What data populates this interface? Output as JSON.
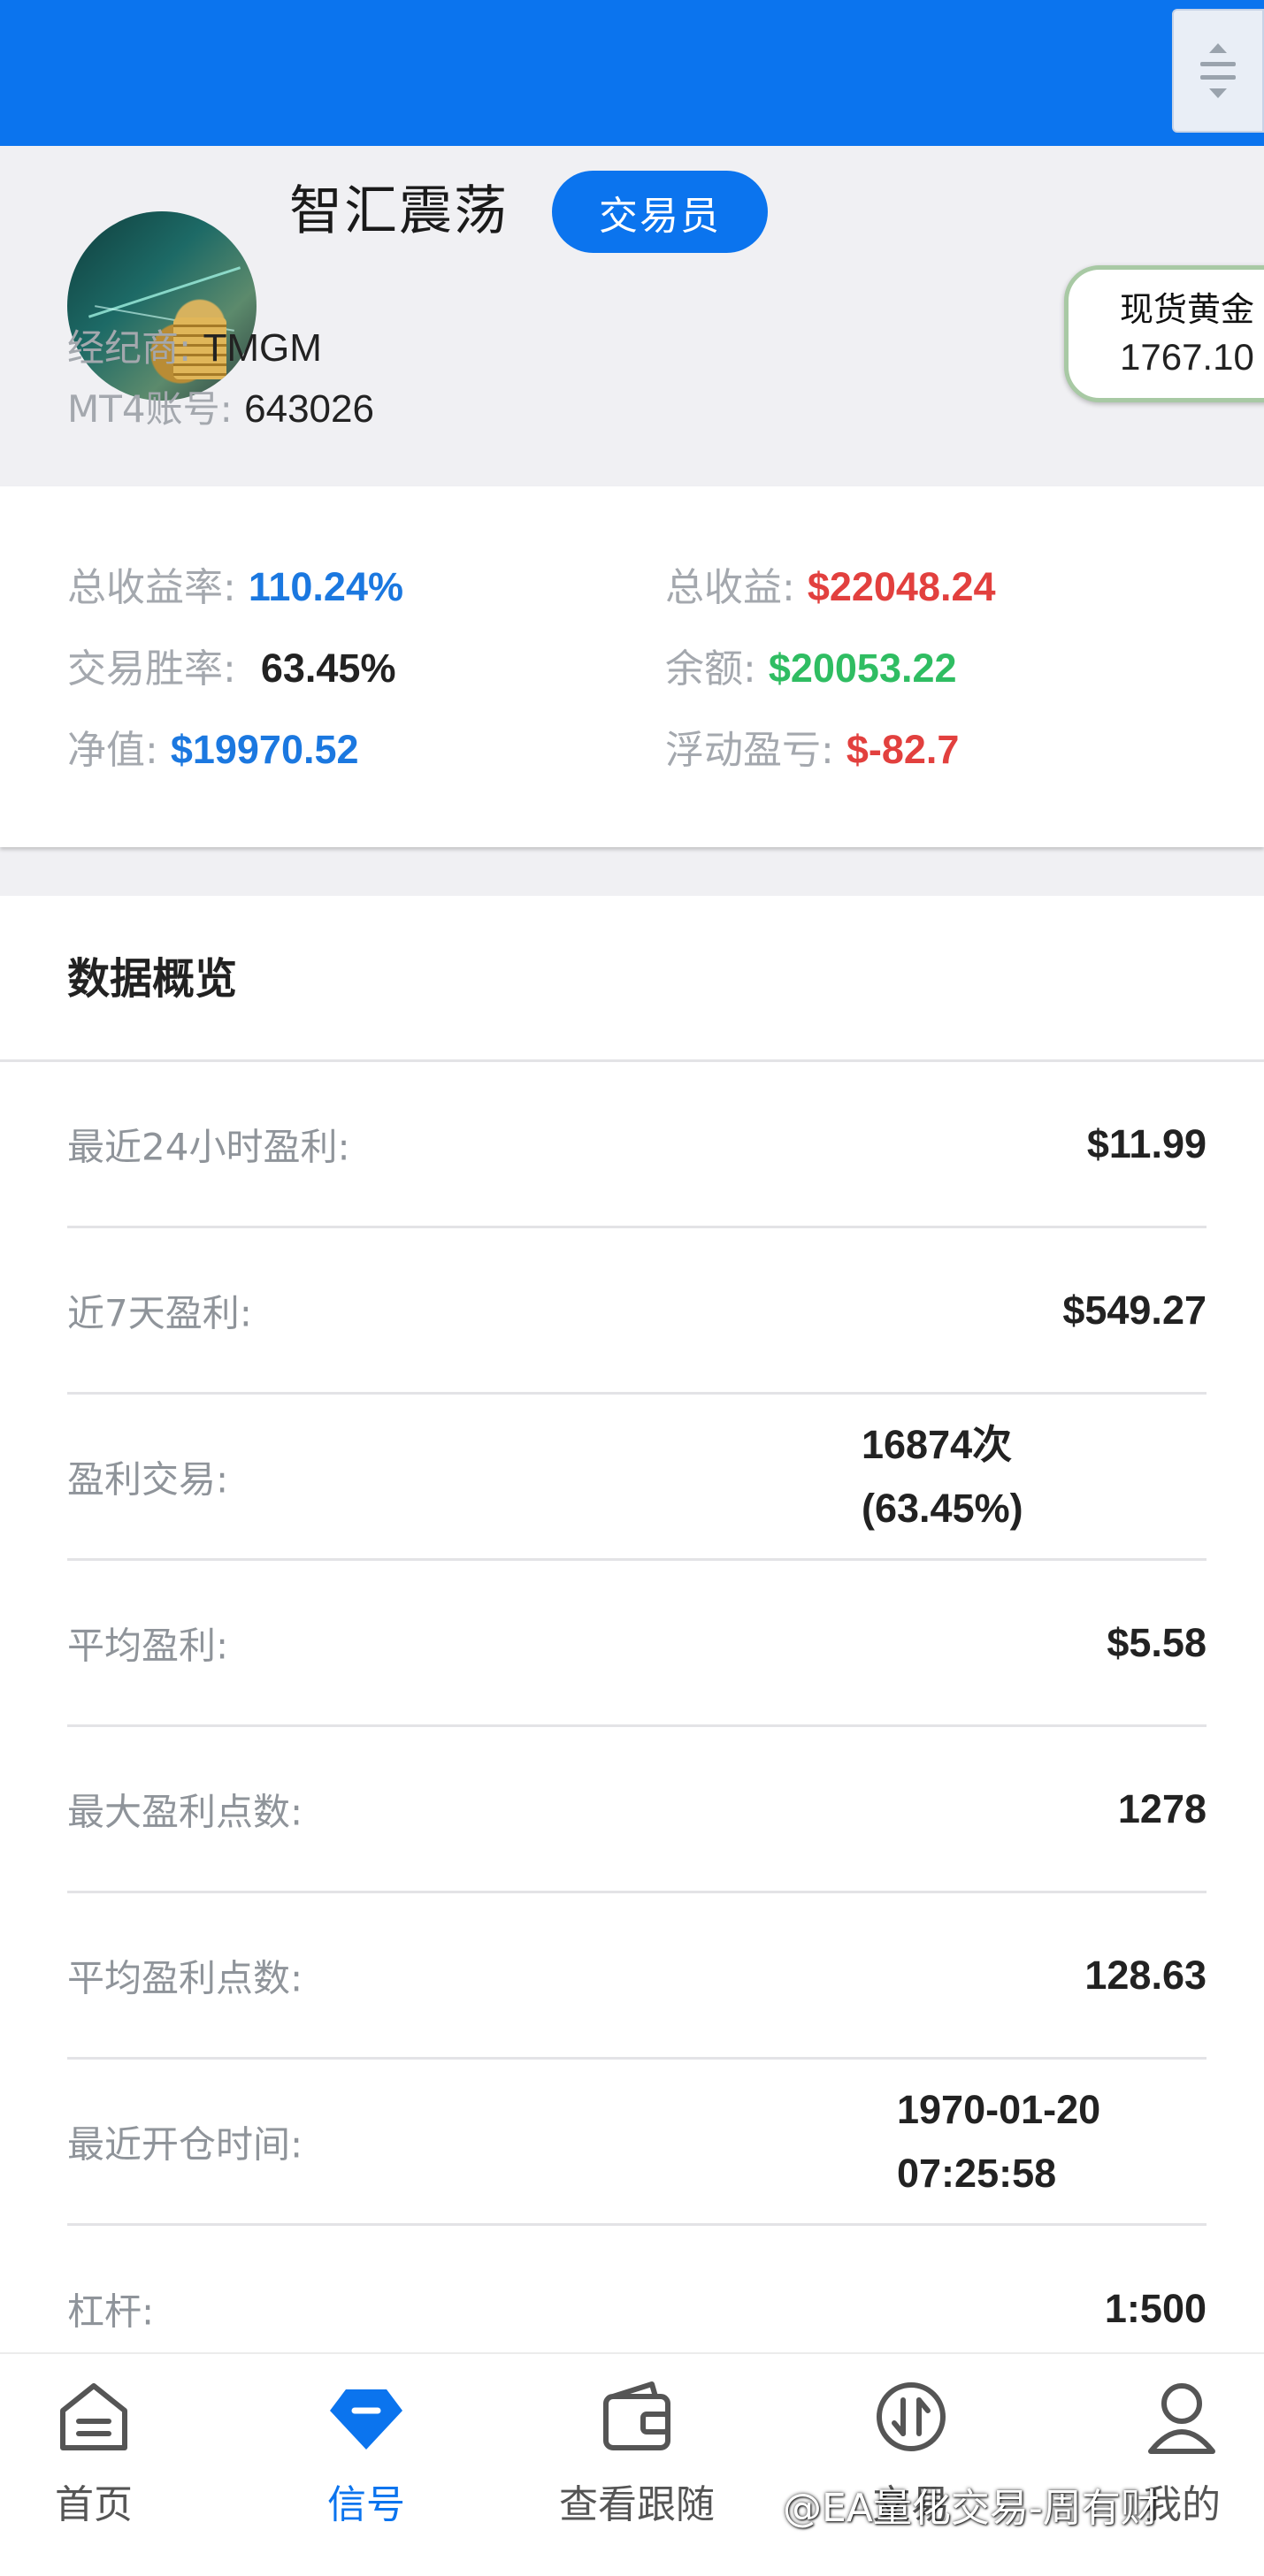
{
  "header": {
    "bg_color": "#0b74ee"
  },
  "profile": {
    "name": "智汇震荡",
    "badge": "交易员",
    "broker_label": "经纪商:",
    "broker_value": "TMGM",
    "account_label": "MT4账号:",
    "account_value": "643026"
  },
  "gold_ticker": {
    "label": "现货黄金",
    "price": "1767.10"
  },
  "stats": {
    "total_return_rate_label": "总收益率:",
    "total_return_rate_value": "110.24%",
    "total_profit_label": "总收益:",
    "total_profit_value": "$22048.24",
    "win_rate_label": "交易胜率:",
    "win_rate_value": "63.45%",
    "balance_label": "余额:",
    "balance_value": "$20053.22",
    "equity_label": "净值:",
    "equity_value": "$19970.52",
    "floating_label": "浮动盈亏:",
    "floating_value": "$-82.7"
  },
  "overview": {
    "title": "数据概览",
    "rows": [
      {
        "label": "最近24小时盈利:",
        "value": "$11.99"
      },
      {
        "label": "近7天盈利:",
        "value": "$549.27"
      },
      {
        "label": "盈利交易:",
        "value_line1": "16874次",
        "value_line2": "(63.45%)"
      },
      {
        "label": "平均盈利:",
        "value": "$5.58"
      },
      {
        "label": "最大盈利点数:",
        "value": "1278"
      },
      {
        "label": "平均盈利点数:",
        "value": "128.63"
      },
      {
        "label": "最近开仓时间:",
        "value_line1": "1970-01-20",
        "value_line2": "07:25:58"
      },
      {
        "label": "杠杆:",
        "value": "1:500"
      }
    ]
  },
  "tabbar": {
    "items": [
      {
        "label": "首页",
        "icon": "home-icon"
      },
      {
        "label": "信号",
        "icon": "diamond-icon",
        "active": true
      },
      {
        "label": "查看跟随",
        "icon": "wallet-icon"
      },
      {
        "label": "交易",
        "icon": "trade-icon"
      },
      {
        "label": "我的",
        "icon": "user-icon"
      }
    ]
  },
  "watermark": "@EA量化交易-周有财"
}
